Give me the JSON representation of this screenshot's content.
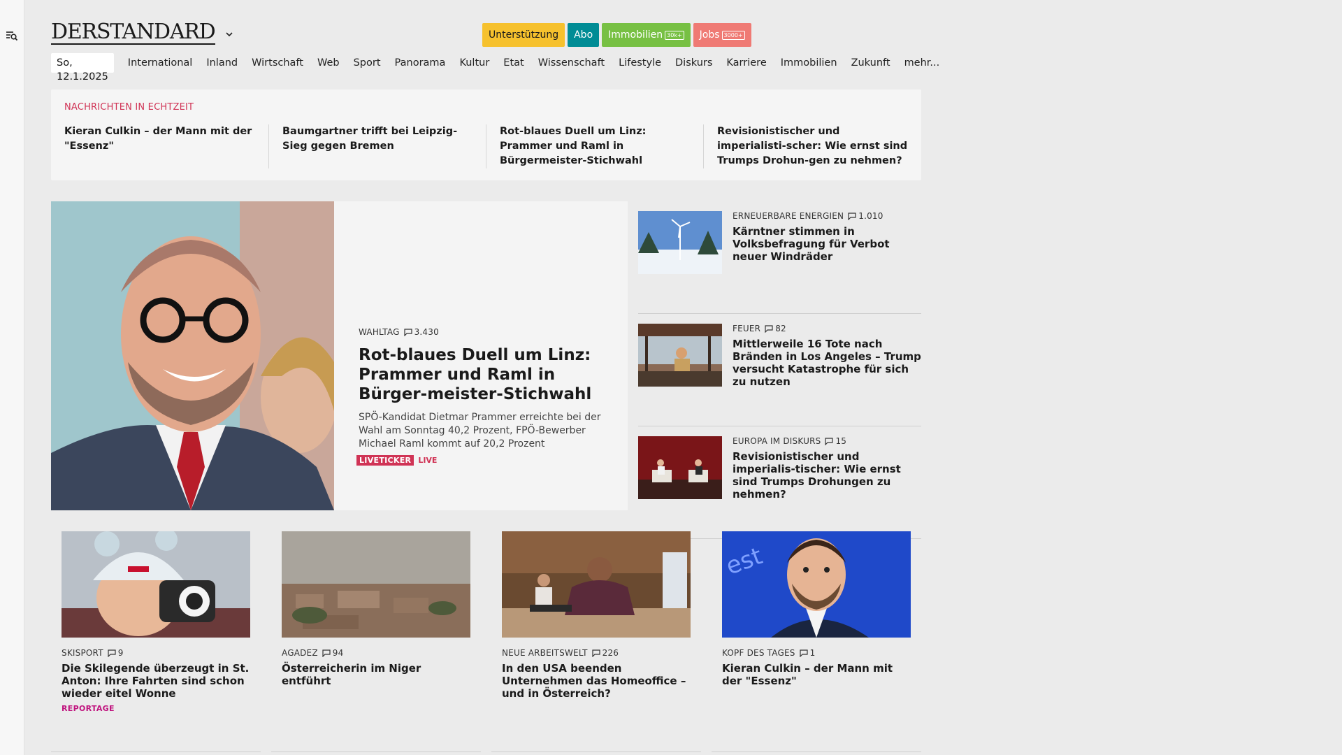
{
  "header": {
    "logo": "DERSTANDARD",
    "pills": {
      "support": "Unterstützung",
      "abo": "Abo",
      "immobilien": "Immobilien",
      "immobilien_badge": "30k+",
      "jobs": "Jobs",
      "jobs_badge": "3000+"
    }
  },
  "nav": {
    "date": "So, 12.1.2025",
    "items": [
      "International",
      "Inland",
      "Wirtschaft",
      "Web",
      "Sport",
      "Panorama",
      "Kultur",
      "Etat",
      "Wissenschaft",
      "Lifestyle",
      "Diskurs",
      "Karriere",
      "Immobilien",
      "Zukunft",
      "mehr..."
    ]
  },
  "realtime": {
    "label": "NACHRICHTEN IN ECHTZEIT",
    "items": [
      "Kieran Culkin – der Mann mit der \"Essenz\"",
      "Baumgartner trifft bei Leipzig-Sieg gegen Bremen",
      "Rot-blaues Duell um Linz: Prammer und Raml in Bürgermeister-Stichwahl",
      "Revisionistischer und imperialisti-scher: Wie ernst sind Trumps Drohun-gen zu nehmen?"
    ]
  },
  "hero": {
    "kicker": "WAHLTAG",
    "comments": "3.430",
    "title": "Rot-blaues Duell um Linz: Prammer und Raml in Bürger-meister-Stichwahl",
    "lead": "SPÖ-Kandidat Dietmar Prammer erreichte bei der Wahl am Sonntag 40,2 Prozent, FPÖ-Bewerber Michael Raml kommt auf 20,2 Prozent",
    "tag_box": "LIVETICKER",
    "tag_text": "LIVE"
  },
  "side": [
    {
      "kicker": "ERNEUERBARE ENERGIEN",
      "comments": "1.010",
      "title": "Kärntner stimmen in Volksbefragung für Verbot neuer Windräder"
    },
    {
      "kicker": "FEUER",
      "comments": "82",
      "title": "Mittlerweile 16 Tote nach Bränden in Los Angeles – Trump versucht Katastrophe für sich zu nutzen"
    },
    {
      "kicker": "EUROPA IM DISKURS",
      "comments": "15",
      "title": "Revisionistischer und imperialis-tischer: Wie ernst sind Trumps Drohungen zu nehmen?"
    }
  ],
  "teasers": [
    {
      "kicker": "SKISPORT",
      "comments": "9",
      "title": "Die Skilegende überzeugt in St. Anton: Ihre Fahrten sind schon wieder eitel Wonne",
      "tag": "REPORTAGE"
    },
    {
      "kicker": "AGADEZ",
      "comments": "94",
      "title": "Österreicherin im Niger entführt",
      "tag": ""
    },
    {
      "kicker": "NEUE ARBEITSWELT",
      "comments": "226",
      "title": "In den USA beenden Unternehmen das Homeoffice – und in Österreich?",
      "tag": ""
    },
    {
      "kicker": "KOPF DES TAGES",
      "comments": "1",
      "title": "Kieran Culkin – der Mann mit der \"Essenz\"",
      "tag": ""
    }
  ],
  "colors": {
    "background": "#ebebeb",
    "realtime_label": "#d03355",
    "support": "#f6c12d",
    "abo": "#008c95",
    "immobilien": "#77c043",
    "jobs": "#ef7a74",
    "reportage": "#c0157f"
  },
  "icons": {
    "menu": "menu-search-icon",
    "logo_dropdown": "chevron-down-icon",
    "comment": "comment-bubble-icon"
  }
}
